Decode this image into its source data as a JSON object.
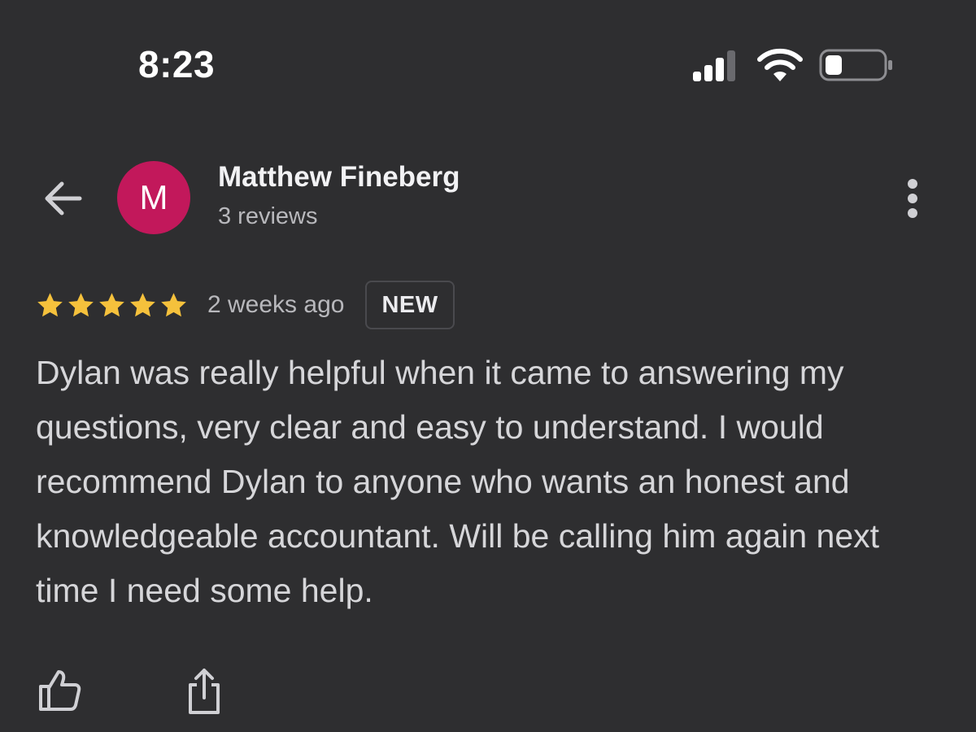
{
  "status_bar": {
    "time": "8:23",
    "icons": [
      "cellular-signal-icon",
      "wifi-icon",
      "battery-icon"
    ]
  },
  "header": {
    "back_icon": "arrow-left-icon",
    "avatar_letter": "M",
    "avatar_color": "#c2185b",
    "reviewer_name": "Matthew Fineberg",
    "review_count": "3 reviews",
    "more_icon": "more-vertical-icon"
  },
  "review": {
    "rating": 5,
    "max_rating": 5,
    "star_color": "#f5c13c",
    "date": "2 weeks ago",
    "badge": "NEW",
    "text": "Dylan was really helpful when it came to answering my questions, very clear and easy to understand. I would recommend Dylan to anyone who wants an honest and knowledgeable accountant. Will be calling him again next time I need some help."
  },
  "actions": {
    "like_icon": "thumbs-up-icon",
    "share_icon": "share-icon"
  }
}
